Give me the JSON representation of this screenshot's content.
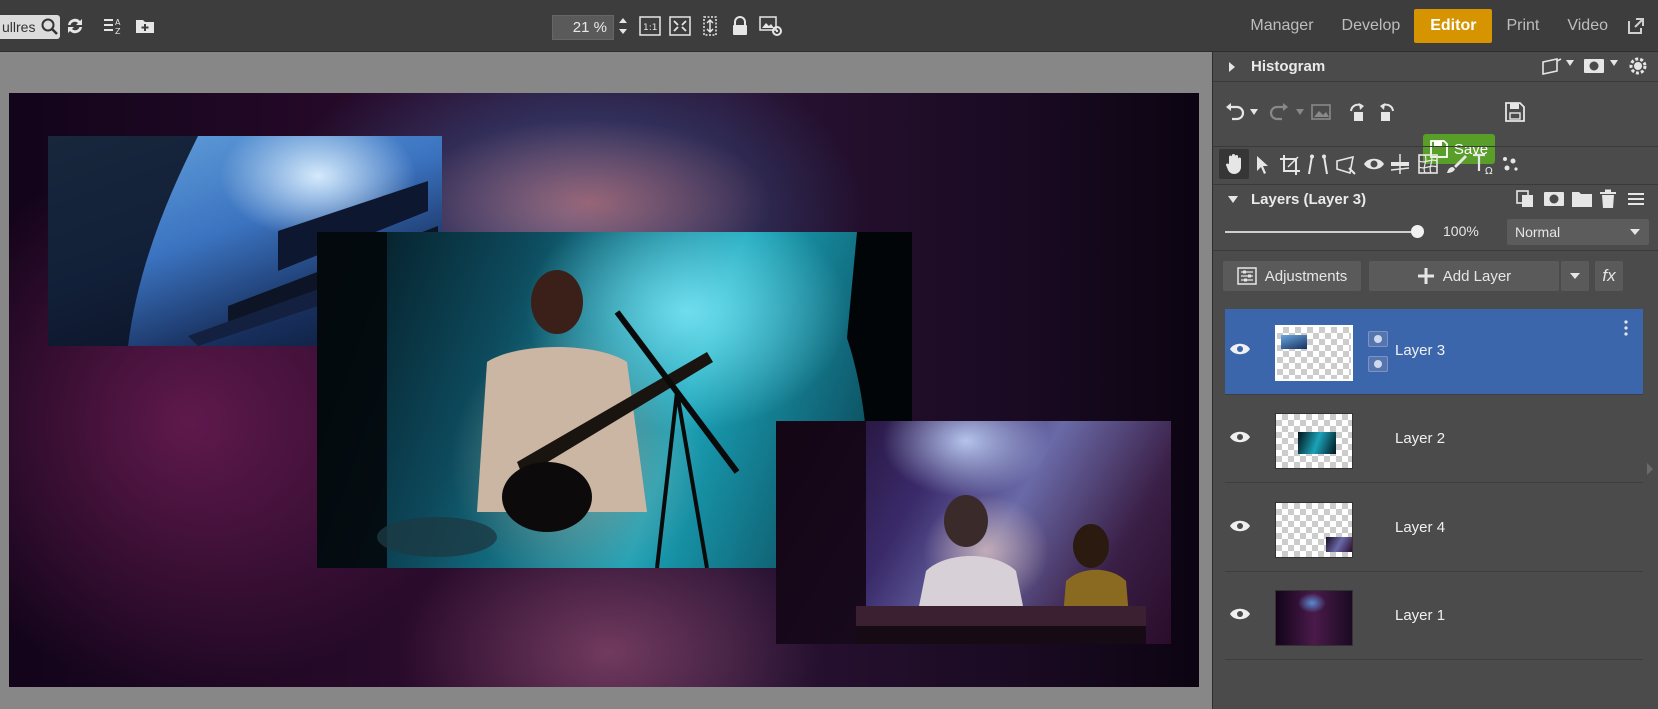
{
  "toolbar": {
    "search_value": "ullres",
    "zoom_value": "21 %",
    "zoom_1to1_label": "1:1"
  },
  "modules": [
    {
      "label": "Manager",
      "active": false
    },
    {
      "label": "Develop",
      "active": false
    },
    {
      "label": "Editor",
      "active": true
    },
    {
      "label": "Print",
      "active": false
    },
    {
      "label": "Video",
      "active": false
    }
  ],
  "panel": {
    "histogram_title": "Histogram",
    "save_label": "Save",
    "layers_title": "Layers (Layer 3)",
    "opacity_value": "100%",
    "opacity_level": 1.0,
    "blend_mode": "Normal",
    "adjustments_label": "Adjustments",
    "add_layer_label": "Add Layer",
    "fx_label": "fx"
  },
  "layers": [
    {
      "name": "Layer 3",
      "selected": true
    },
    {
      "name": "Layer 2",
      "selected": false
    },
    {
      "name": "Layer 4",
      "selected": false
    },
    {
      "name": "Layer 1",
      "selected": false
    }
  ],
  "colors": {
    "accent_active_module": "#d59400",
    "save_button": "#5a9e2a",
    "selected_layer": "#3c66ac"
  }
}
